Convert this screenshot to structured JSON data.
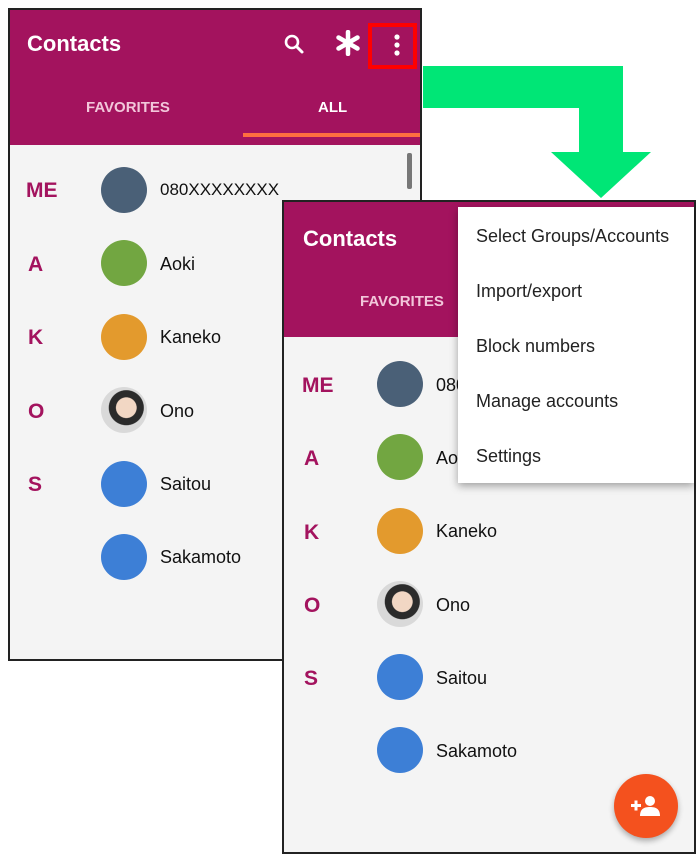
{
  "app": {
    "title": "Contacts"
  },
  "tabs": {
    "favorites": "FAVORITES",
    "all": "ALL"
  },
  "colors": {
    "appbar": "#a3135e",
    "accent": "#ff6e40",
    "fab": "#f4511e",
    "arrow": "#00e676",
    "highlight": "#ff0000"
  },
  "phone1": {
    "sections": [
      {
        "letter": "ME",
        "name": "080XXXXXXXX",
        "avatar_color": "#4a6077"
      },
      {
        "letter": "A",
        "name": "Aoki",
        "avatar_color": "#72a641"
      },
      {
        "letter": "K",
        "name": "Kaneko",
        "avatar_color": "#e39a2d"
      },
      {
        "letter": "O",
        "name": "Ono",
        "avatar_color": "photo"
      },
      {
        "letter": "S",
        "name": "Saitou",
        "avatar_color": "#3d7fd6"
      },
      {
        "letter": "",
        "name": "Sakamoto",
        "avatar_color": "#3d7fd6"
      }
    ]
  },
  "phone2": {
    "sections": [
      {
        "letter": "ME",
        "name": "080",
        "avatar_color": "#4a6077"
      },
      {
        "letter": "A",
        "name": "Ao",
        "avatar_color": "#72a641"
      },
      {
        "letter": "K",
        "name": "Kaneko",
        "avatar_color": "#e39a2d"
      },
      {
        "letter": "O",
        "name": "Ono",
        "avatar_color": "photo"
      },
      {
        "letter": "S",
        "name": "Saitou",
        "avatar_color": "#3d7fd6"
      },
      {
        "letter": "",
        "name": "Sakamoto",
        "avatar_color": "#3d7fd6"
      }
    ]
  },
  "menu": {
    "items": [
      "Select Groups/Accounts",
      "Import/export",
      "Block numbers",
      "Manage accounts",
      "Settings"
    ]
  },
  "icons": {
    "search": "search-icon",
    "asterisk": "asterisk-icon",
    "more": "more-vert-icon",
    "fab": "add-contact-icon"
  }
}
